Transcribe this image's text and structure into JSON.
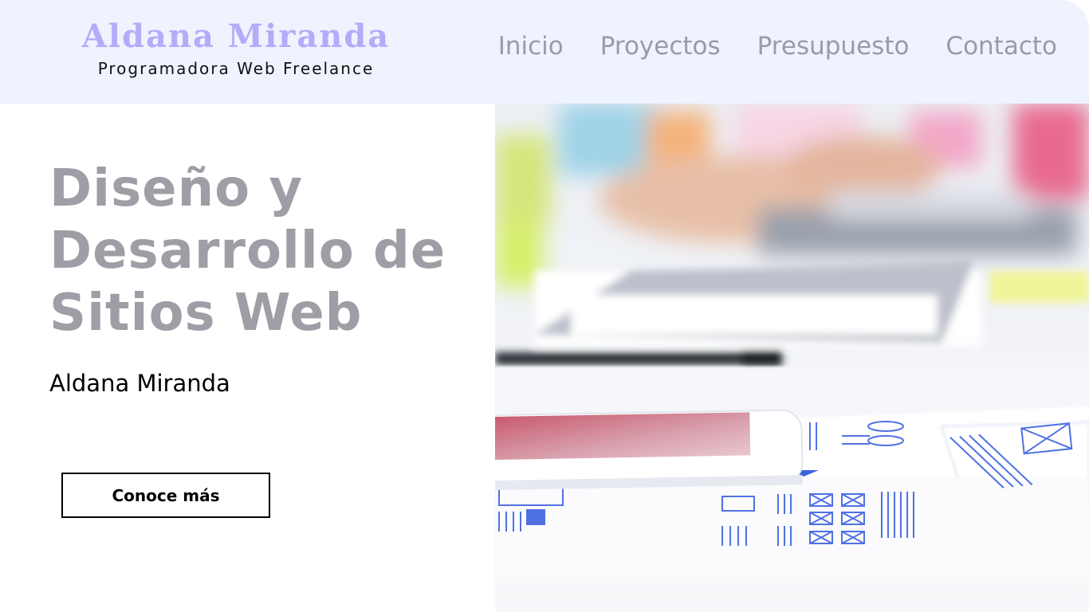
{
  "brand": {
    "name": "Aldana Miranda",
    "tagline": "Programadora Web Freelance"
  },
  "nav": {
    "items": [
      "Inicio",
      "Proyectos",
      "Presupuesto",
      "Contacto"
    ]
  },
  "hero": {
    "title_lines": [
      "Diseño y",
      "Desarrollo de",
      "Sitios Web"
    ],
    "author": "Aldana Miranda",
    "cta_label": "Conoce más",
    "image_icon": "laptop-wireframes-photo"
  },
  "colors": {
    "header_bg": "#eef3fe",
    "brand": "#b3acf8",
    "nav_text": "#9a9aa8",
    "title_text": "#9e9ea6",
    "wireframe_blue": "#3d63e0"
  }
}
